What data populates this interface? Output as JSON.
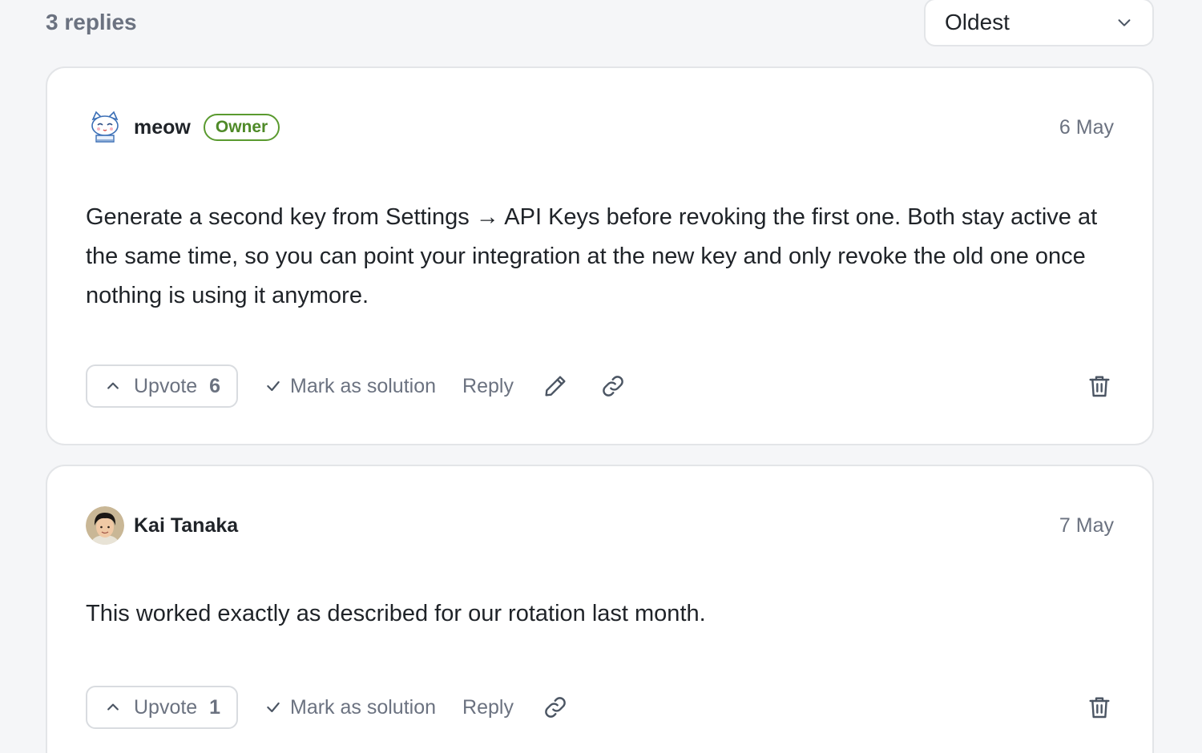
{
  "header": {
    "replies_count": "3 replies",
    "sort": {
      "selected": "Oldest",
      "icon": "chevron-down-icon"
    }
  },
  "replies": [
    {
      "author": "meow",
      "badge": "Owner",
      "avatar": "cat-avatar",
      "date": "6 May",
      "body": "Generate a second key from Settings → API Keys before revoking the first one. Both stay active at the same time, so you can point your integration at the new key and only revoke the old one once nothing is using it anymore.",
      "upvote_label": "Upvote",
      "upvote_count": "6",
      "mark_solution_label": "Mark as solution",
      "reply_label": "Reply",
      "icons": [
        "chevron-up-icon",
        "check-icon",
        "pencil-icon",
        "link-icon",
        "trash-icon"
      ]
    },
    {
      "author": "Kai Tanaka",
      "avatar": "photo-avatar",
      "date": "7 May",
      "body": "This worked exactly as described for our rotation last month.",
      "upvote_label": "Upvote",
      "upvote_count": "1",
      "mark_solution_label": "Mark as solution",
      "reply_label": "Reply",
      "icons": [
        "chevron-up-icon",
        "check-icon",
        "link-icon",
        "trash-icon"
      ]
    }
  ],
  "colors": {
    "background": "#f5f6f8",
    "card": "#ffffff",
    "border": "#e3e5e8",
    "muted_text": "#6b7280",
    "owner_badge": "#4f8a28"
  }
}
